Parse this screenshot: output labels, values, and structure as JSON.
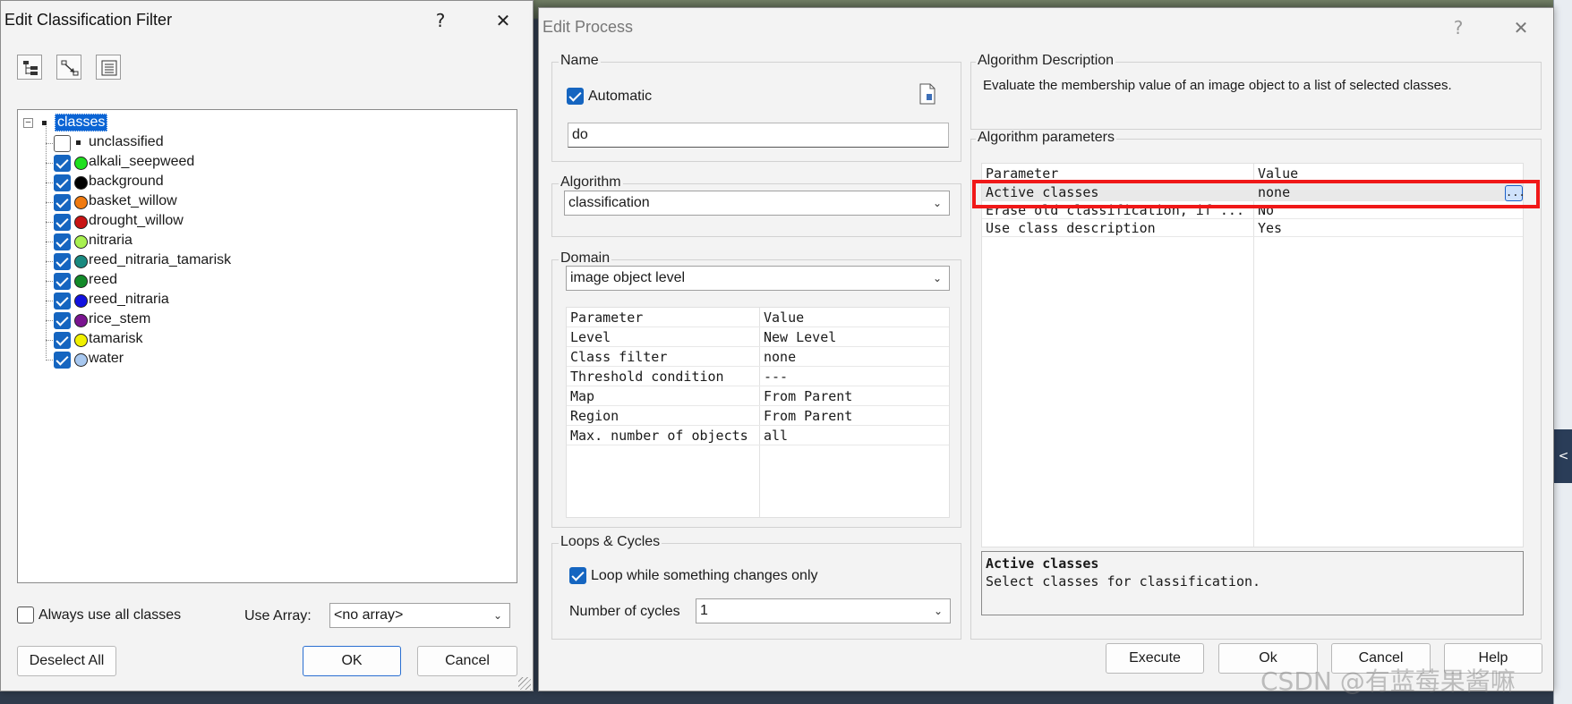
{
  "left_dialog": {
    "title": "Edit Classification Filter",
    "help_glyph": "?",
    "close_glyph": "✕",
    "tree": {
      "root_label": "classes",
      "unclassified_label": "unclassified",
      "classes": [
        {
          "label": "alkali_seepweed",
          "color": "#1fe01f",
          "checked": true
        },
        {
          "label": "background",
          "color": "#000000",
          "checked": true
        },
        {
          "label": "basket_willow",
          "color": "#f07a10",
          "checked": true
        },
        {
          "label": "drought_willow",
          "color": "#c81414",
          "checked": true
        },
        {
          "label": "nitraria",
          "color": "#a8f050",
          "checked": true
        },
        {
          "label": "reed_nitraria_tamarisk",
          "color": "#1a8a80",
          "checked": true
        },
        {
          "label": "reed",
          "color": "#138a2a",
          "checked": true
        },
        {
          "label": "reed_nitraria",
          "color": "#1212e0",
          "checked": true
        },
        {
          "label": "rice_stem",
          "color": "#7a1490",
          "checked": true
        },
        {
          "label": "tamarisk",
          "color": "#f0f000",
          "checked": true
        },
        {
          "label": "water",
          "color": "#a8c8f0",
          "checked": true
        }
      ]
    },
    "always_use_all_label": "Always use all classes",
    "use_array_label": "Use Array:",
    "use_array_value": "<no array>",
    "deselect_all_label": "Deselect All",
    "ok_label": "OK",
    "cancel_label": "Cancel"
  },
  "right_dialog": {
    "title": "Edit Process",
    "help_glyph": "?",
    "close_glyph": "✕",
    "name": {
      "group_label": "Name",
      "automatic_label": "Automatic",
      "automatic_checked": true,
      "value": "do"
    },
    "algorithm": {
      "group_label": "Algorithm",
      "value": "classification"
    },
    "domain": {
      "group_label": "Domain",
      "value": "image object level",
      "header_param": "Parameter",
      "header_value": "Value",
      "rows": [
        {
          "param": "Level",
          "value": "New Level"
        },
        {
          "param": "Class filter",
          "value": "none"
        },
        {
          "param": "Threshold condition",
          "value": "---"
        },
        {
          "param": "Map",
          "value": "From Parent"
        },
        {
          "param": "Region",
          "value": "From Parent"
        },
        {
          "param": "Max. number of objects",
          "value": "all"
        }
      ]
    },
    "loops": {
      "group_label": "Loops & Cycles",
      "loop_label": "Loop while something changes only",
      "loop_checked": true,
      "cycles_label": "Number of cycles",
      "cycles_value": "1"
    },
    "description": {
      "group_label": "Algorithm Description",
      "text": "Evaluate the membership value of an image object to a list of selected classes."
    },
    "parameters": {
      "group_label": "Algorithm parameters",
      "header_param": "Parameter",
      "header_value": "Value",
      "rows": [
        {
          "param": "Active classes",
          "value": "none"
        },
        {
          "param": "Erase old classification, if ...",
          "value": "No"
        },
        {
          "param": "Use class description",
          "value": "Yes"
        }
      ],
      "ellipsis_label": "...",
      "help_title": "Active classes",
      "help_text": "Select classes for classification."
    },
    "buttons": {
      "execute": "Execute",
      "ok": "Ok",
      "cancel": "Cancel",
      "help": "Help"
    }
  },
  "side_tab_glyph": "<",
  "watermark": "CSDN @有蓝莓果酱嘛"
}
